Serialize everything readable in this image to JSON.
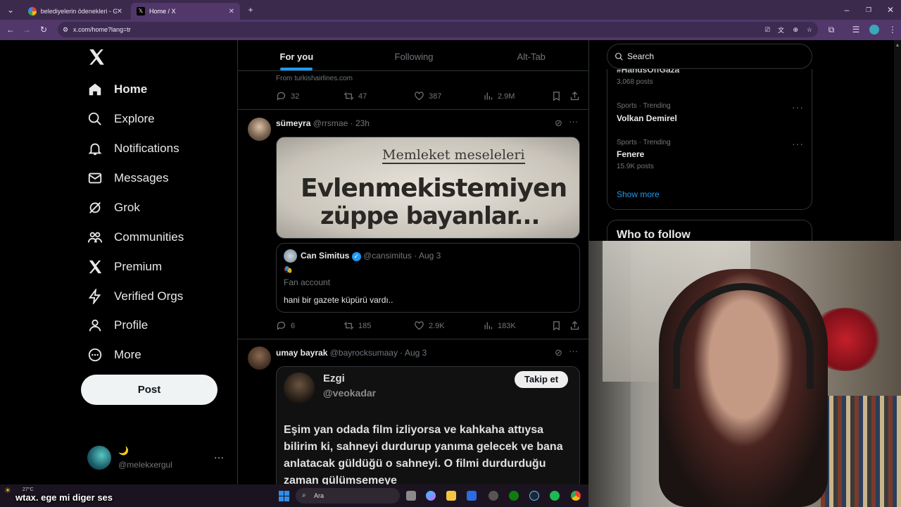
{
  "browser": {
    "tabs": [
      {
        "title": "belediyelerin ödenekleri - Goog"
      },
      {
        "title": "Home / X"
      }
    ],
    "url": "x.com/home?lang=tr"
  },
  "sidebar": {
    "items": [
      {
        "label": "Home",
        "icon": "home-icon"
      },
      {
        "label": "Explore",
        "icon": "search-icon"
      },
      {
        "label": "Notifications",
        "icon": "bell-icon"
      },
      {
        "label": "Messages",
        "icon": "envelope-icon"
      },
      {
        "label": "Grok",
        "icon": "grok-icon"
      },
      {
        "label": "Communities",
        "icon": "people-icon"
      },
      {
        "label": "Premium",
        "icon": "x-logo-icon"
      },
      {
        "label": "Verified Orgs",
        "icon": "lightning-icon"
      },
      {
        "label": "Profile",
        "icon": "person-icon"
      },
      {
        "label": "More",
        "icon": "more-circle-icon"
      }
    ],
    "post_label": "Post",
    "account": {
      "emoji": "🌙",
      "handle": "@melekxergul"
    }
  },
  "feed": {
    "tabs": [
      "For you",
      "Following",
      "Alt-Tab"
    ],
    "ad": {
      "source": "From turkishairlines.com",
      "replies": "32",
      "reposts": "47",
      "likes": "387",
      "views": "2.9M"
    },
    "tweet1": {
      "name": "sümeyra",
      "handle": "@rrsmae",
      "time": "23h",
      "image_text": {
        "top": "Memleket meseleleri",
        "line1": "Evlenmekistemiyen",
        "line2": "züppe bayanlar..."
      },
      "quote": {
        "name": "Can Simitus",
        "handle": "@cansimitus",
        "time": "Aug 3",
        "emoji": "🎭",
        "subtitle": "Fan account",
        "text": "hani bir gazete küpürü vardı.."
      },
      "replies": "6",
      "reposts": "185",
      "likes": "2.9K",
      "views": "183K"
    },
    "tweet2": {
      "name": "umay bayrak",
      "handle": "@bayrocksumaay",
      "time": "Aug 3",
      "embed": {
        "name": "Ezgi",
        "handle": "@veokadar",
        "follow_label": "Takip et",
        "text": "Eşim yan odada film izliyorsa ve kahkaha attıysa bilirim ki, sahneyi durdurup yanıma gelecek ve bana anlatacak güldüğü o sahneyi. O filmi durdurduğu zaman gülümsemeye"
      }
    }
  },
  "right": {
    "search_placeholder": "Search",
    "trend0": {
      "name": "#HandsOffGaza",
      "posts": "3,068 posts"
    },
    "trend1": {
      "meta": "Sports · Trending",
      "name": "Volkan Demirel"
    },
    "trend2": {
      "meta": "Sports · Trending",
      "name": "Fenere",
      "posts": "15.9K posts"
    },
    "show_more": "Show more",
    "who_to_follow": "Who to follow"
  },
  "taskbar": {
    "weather": "27°C",
    "overlay_text": "wtax. ege mi diger ses",
    "search_label": "Ara"
  },
  "colors": {
    "accent": "#1d9bf0",
    "browser": "#51376a"
  }
}
